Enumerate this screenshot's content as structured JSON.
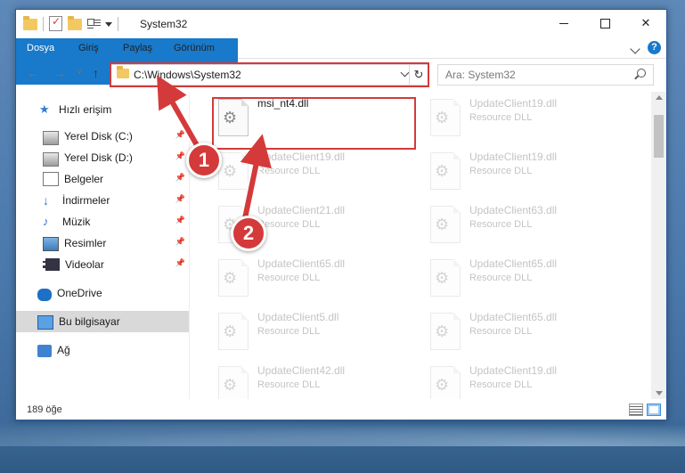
{
  "window": {
    "title": "System32",
    "controls": {
      "minimize": "minimize-icon",
      "maximize": "maximize-icon",
      "close": "✕"
    }
  },
  "ribbon": {
    "tabs": [
      "Dosya",
      "Giriş",
      "Paylaş",
      "Görünüm"
    ],
    "help": "?"
  },
  "navbar": {
    "back": "←",
    "forward": "→",
    "recent": "˅",
    "up": "↑",
    "address": "C:\\Windows\\System32",
    "refresh": "↻",
    "search_placeholder": "Ara: System32"
  },
  "sidebar": {
    "items": [
      {
        "label": "Hızlı erişim",
        "icon": "star-icon",
        "pinned": false
      },
      {
        "label": "Yerel Disk (C:)",
        "icon": "drive-icon",
        "pinned": true
      },
      {
        "label": "Yerel Disk (D:)",
        "icon": "drive-icon",
        "pinned": true
      },
      {
        "label": "Belgeler",
        "icon": "documents-icon",
        "pinned": true
      },
      {
        "label": "İndirmeler",
        "icon": "downloads-icon",
        "pinned": true
      },
      {
        "label": "Müzik",
        "icon": "music-icon",
        "pinned": true
      },
      {
        "label": "Resimler",
        "icon": "pictures-icon",
        "pinned": true
      },
      {
        "label": "Videolar",
        "icon": "videos-icon",
        "pinned": true
      },
      {
        "label": "OneDrive",
        "icon": "onedrive-icon",
        "pinned": false
      },
      {
        "label": "Bu bilgisayar",
        "icon": "computer-icon",
        "pinned": false,
        "selected": true
      },
      {
        "label": "Ağ",
        "icon": "network-icon",
        "pinned": false
      }
    ]
  },
  "files": [
    {
      "name": "msi_nt4.dll",
      "type": "",
      "highlighted": true
    },
    {
      "name": "UpdateClient19.dll",
      "type": "Resource DLL"
    },
    {
      "name": "UpdateClient19.dll",
      "type": "Resource DLL"
    },
    {
      "name": "UpdateClient19.dll",
      "type": "Resource DLL"
    },
    {
      "name": "UpdateClient21.dll",
      "type": "Resource DLL"
    },
    {
      "name": "UpdateClient63.dll",
      "type": "Resource DLL"
    },
    {
      "name": "UpdateClient65.dll",
      "type": "Resource DLL"
    },
    {
      "name": "UpdateClient65.dll",
      "type": "Resource DLL"
    },
    {
      "name": "UpdateClient5.dll",
      "type": "Resource DLL"
    },
    {
      "name": "UpdateClient65.dll",
      "type": "Resource DLL"
    },
    {
      "name": "UpdateClient42.dll",
      "type": "Resource DLL"
    },
    {
      "name": "UpdateClient19.dll",
      "type": "Resource DLL"
    }
  ],
  "status": {
    "count": "189 öğe"
  },
  "annotations": {
    "step1": "1",
    "step2": "2",
    "color": "#d43a3a"
  }
}
